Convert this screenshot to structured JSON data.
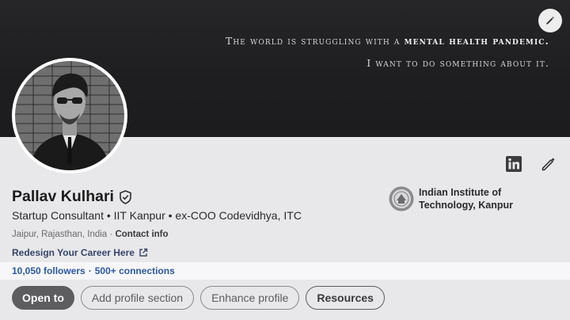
{
  "banner": {
    "line1_pre": "The world is struggling with a ",
    "line1_bold": "mental health pandemic.",
    "line2": "I want to do something about it.",
    "edit_icon": "pencil-icon"
  },
  "profile": {
    "name": "Pallav Kulhari",
    "verified_icon": "verified-shield-icon",
    "headline": "Startup Consultant • IIT Kanpur • ex-COO Codevidhya, ITC",
    "location": "Jaipur, Rajasthan, India",
    "location_sep": " · ",
    "contact_label": "Contact info",
    "website_label": "Redesign Your Career Here",
    "followers": "10,050 followers",
    "connections": "500+ connections",
    "stats_sep": "·"
  },
  "education": {
    "name": "Indian Institute of Technology, Kanpur",
    "logo_icon": "iit-kanpur-seal-icon"
  },
  "top_actions": {
    "linkedin_icon": "linkedin-icon",
    "edit_icon": "pencil-icon"
  },
  "buttons": {
    "open_to": "Open to",
    "add_section": "Add profile section",
    "enhance": "Enhance profile",
    "resources": "Resources"
  },
  "colors": {
    "banner_bg": "#1e1e20",
    "link_blue": "#2b58a8",
    "primary_button": "#5d5d60"
  }
}
